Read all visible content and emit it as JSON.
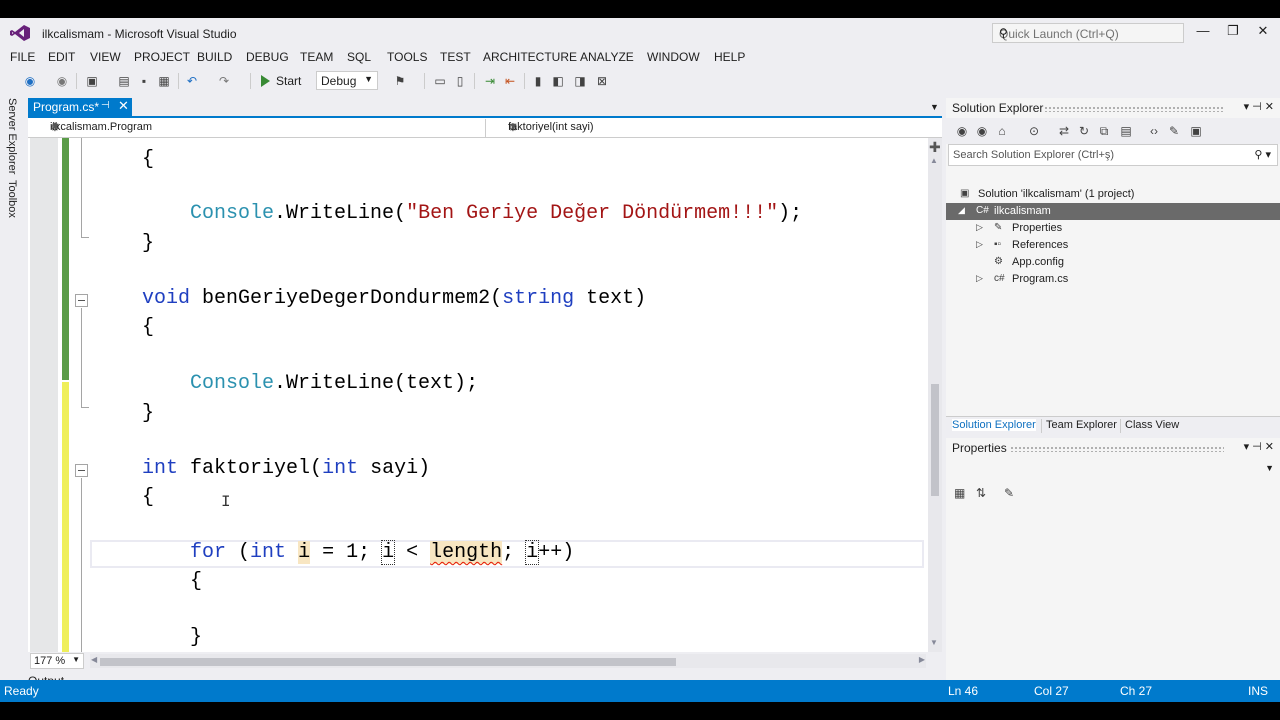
{
  "window": {
    "title": "ilkcalismam - Microsoft Visual Studio",
    "quick_launch_placeholder": "Quick Launch (Ctrl+Q)"
  },
  "menu": [
    "FILE",
    "EDIT",
    "VIEW",
    "PROJECT",
    "BUILD",
    "DEBUG",
    "TEAM",
    "SQL",
    "TOOLS",
    "TEST",
    "ARCHITECTURE",
    "ANALYZE",
    "WINDOW",
    "HELP"
  ],
  "toolbar": {
    "start_label": "Start",
    "config_value": "Debug"
  },
  "side_tabs": [
    "Server Explorer",
    "Toolbox"
  ],
  "document_tab": {
    "label": "Program.cs*"
  },
  "navigation": {
    "type_scope": "ilkcalismam.Program",
    "member_scope": "faktoriyel(int sayi)"
  },
  "code": {
    "lines": [
      "    {",
      "        Console.WriteLine(\"Ben Geriye Değer Döndürmem!!!\");",
      "    }",
      "",
      "    void benGeriyeDegerDondurmem2(string text)",
      "    {",
      "        Console.WriteLine(text);",
      "    }",
      "",
      "    int faktoriyel(int sayi)",
      "    {",
      "        for (int i = 1; i < length; i++)",
      "        {",
      "",
      "        }"
    ]
  },
  "zoom": "177 %",
  "output_tab": "Output",
  "solution_explorer": {
    "title": "Solution Explorer",
    "search_placeholder": "Search Solution Explorer (Ctrl+ş)",
    "solution": "Solution 'ilkcalismam' (1 project)",
    "project": "ilkcalismam",
    "items": [
      "Properties",
      "References",
      "App.config",
      "Program.cs"
    ]
  },
  "bottom_tabs": [
    "Solution Explorer",
    "Team Explorer",
    "Class View"
  ],
  "properties": {
    "title": "Properties"
  },
  "status": {
    "ready": "Ready",
    "ln": "Ln 46",
    "col": "Col 27",
    "ch": "Ch 27",
    "ins": "INS"
  },
  "colors": {
    "accent": "#007acc",
    "keyword": "#1f3fc0",
    "type": "#2b91af",
    "string": "#a31515"
  }
}
